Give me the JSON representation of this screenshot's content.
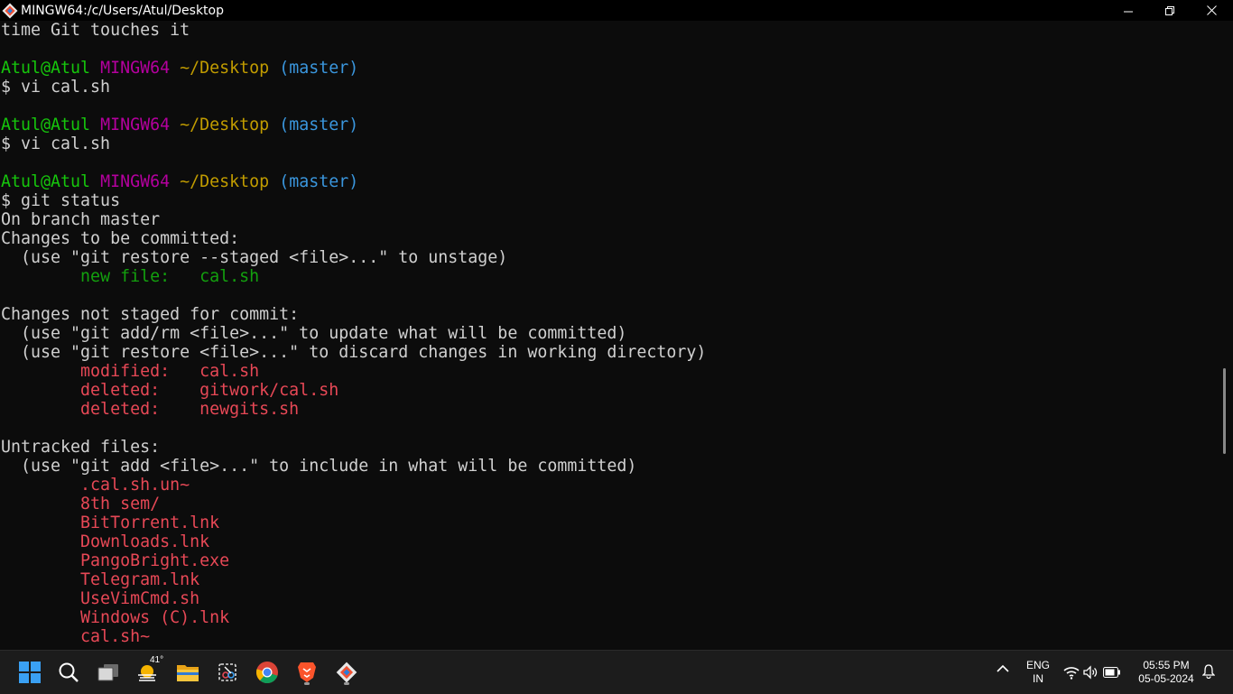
{
  "window": {
    "title": "MINGW64:/c/Users/Atul/Desktop"
  },
  "colors": {
    "terminal_bg": "#0c0c0c",
    "default_text": "#d0d0d0",
    "prompt_user": "#16c60c",
    "prompt_mingw": "#b4009e",
    "prompt_path": "#c19c00",
    "prompt_branch": "#3a96dd",
    "staged": "#13a10e",
    "unstaged": "#e74856"
  },
  "terminal": {
    "lines": [
      {
        "segments": [
          {
            "text": "time Git touches it",
            "color": "#d0d0d0"
          }
        ]
      },
      {
        "segments": []
      },
      {
        "segments": [
          {
            "text": "Atul@Atul ",
            "color": "#16c60c"
          },
          {
            "text": "MINGW64 ",
            "color": "#b4009e"
          },
          {
            "text": "~/Desktop ",
            "color": "#c19c00"
          },
          {
            "text": "(master)",
            "color": "#3a96dd"
          }
        ]
      },
      {
        "segments": [
          {
            "text": "$ vi cal.sh",
            "color": "#d0d0d0"
          }
        ]
      },
      {
        "segments": []
      },
      {
        "segments": [
          {
            "text": "Atul@Atul ",
            "color": "#16c60c"
          },
          {
            "text": "MINGW64 ",
            "color": "#b4009e"
          },
          {
            "text": "~/Desktop ",
            "color": "#c19c00"
          },
          {
            "text": "(master)",
            "color": "#3a96dd"
          }
        ]
      },
      {
        "segments": [
          {
            "text": "$ vi cal.sh",
            "color": "#d0d0d0"
          }
        ]
      },
      {
        "segments": []
      },
      {
        "segments": [
          {
            "text": "Atul@Atul ",
            "color": "#16c60c"
          },
          {
            "text": "MINGW64 ",
            "color": "#b4009e"
          },
          {
            "text": "~/Desktop ",
            "color": "#c19c00"
          },
          {
            "text": "(master)",
            "color": "#3a96dd"
          }
        ]
      },
      {
        "segments": [
          {
            "text": "$ git status",
            "color": "#d0d0d0"
          }
        ]
      },
      {
        "segments": [
          {
            "text": "On branch master",
            "color": "#d0d0d0"
          }
        ]
      },
      {
        "segments": [
          {
            "text": "Changes to be committed:",
            "color": "#d0d0d0"
          }
        ]
      },
      {
        "segments": [
          {
            "text": "  (use \"git restore --staged <file>...\" to unstage)",
            "color": "#d0d0d0"
          }
        ]
      },
      {
        "segments": [
          {
            "text": "        new file:   cal.sh",
            "color": "#13a10e"
          }
        ]
      },
      {
        "segments": []
      },
      {
        "segments": [
          {
            "text": "Changes not staged for commit:",
            "color": "#d0d0d0"
          }
        ]
      },
      {
        "segments": [
          {
            "text": "  (use \"git add/rm <file>...\" to update what will be committed)",
            "color": "#d0d0d0"
          }
        ]
      },
      {
        "segments": [
          {
            "text": "  (use \"git restore <file>...\" to discard changes in working directory)",
            "color": "#d0d0d0"
          }
        ]
      },
      {
        "segments": [
          {
            "text": "        modified:   cal.sh",
            "color": "#e74856"
          }
        ]
      },
      {
        "segments": [
          {
            "text": "        deleted:    gitwork/cal.sh",
            "color": "#e74856"
          }
        ]
      },
      {
        "segments": [
          {
            "text": "        deleted:    newgits.sh",
            "color": "#e74856"
          }
        ]
      },
      {
        "segments": []
      },
      {
        "segments": [
          {
            "text": "Untracked files:",
            "color": "#d0d0d0"
          }
        ]
      },
      {
        "segments": [
          {
            "text": "  (use \"git add <file>...\" to include in what will be committed)",
            "color": "#d0d0d0"
          }
        ]
      },
      {
        "segments": [
          {
            "text": "        .cal.sh.un~",
            "color": "#e74856"
          }
        ]
      },
      {
        "segments": [
          {
            "text": "        8th sem/",
            "color": "#e74856"
          }
        ]
      },
      {
        "segments": [
          {
            "text": "        BitTorrent.lnk",
            "color": "#e74856"
          }
        ]
      },
      {
        "segments": [
          {
            "text": "        Downloads.lnk",
            "color": "#e74856"
          }
        ]
      },
      {
        "segments": [
          {
            "text": "        PangoBright.exe",
            "color": "#e74856"
          }
        ]
      },
      {
        "segments": [
          {
            "text": "        Telegram.lnk",
            "color": "#e74856"
          }
        ]
      },
      {
        "segments": [
          {
            "text": "        UseVimCmd.sh",
            "color": "#e74856"
          }
        ]
      },
      {
        "segments": [
          {
            "text": "        Windows (C).lnk",
            "color": "#e74856"
          }
        ]
      },
      {
        "segments": [
          {
            "text": "        cal.sh~",
            "color": "#e74856"
          }
        ]
      }
    ]
  },
  "taskbar": {
    "weather_temp": "41°",
    "language_line1": "ENG",
    "language_line2": "IN",
    "time": "05:55 PM",
    "date": "05-05-2024",
    "apps": [
      "windows-start",
      "search",
      "task-view",
      "weather",
      "file-explorer",
      "snipping-tool",
      "chrome",
      "brave",
      "git-bash"
    ]
  }
}
